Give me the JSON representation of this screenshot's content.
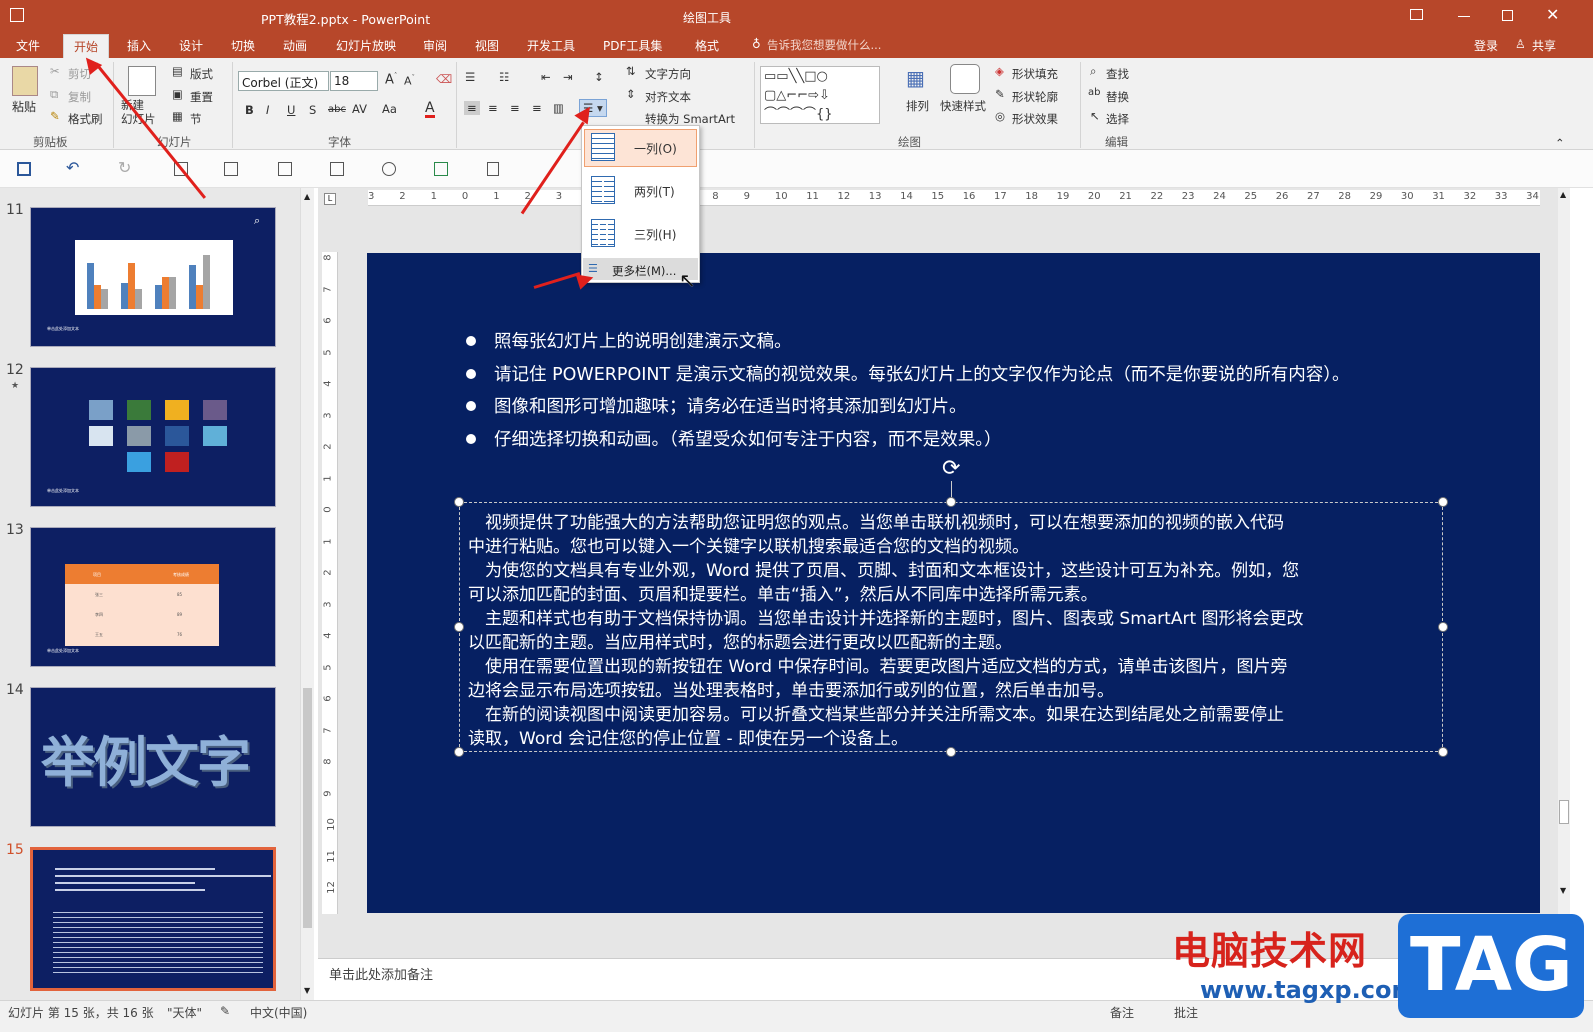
{
  "app": {
    "title": "PPT教程2.pptx - PowerPoint",
    "context_tool": "绘图工具",
    "search_hint": "告诉我您想要做什么...",
    "login": "登录",
    "share": "共享"
  },
  "tabs": [
    "文件",
    "开始",
    "插入",
    "设计",
    "切换",
    "动画",
    "幻灯片放映",
    "审阅",
    "视图",
    "开发工具",
    "PDF工具集",
    "格式"
  ],
  "ribbon": {
    "clipboard": {
      "paste": "粘贴",
      "cut": "剪切",
      "copy": "复制",
      "format_painter": "格式刷",
      "group": "剪贴板"
    },
    "slides": {
      "new_slide": "新建\n幻灯片",
      "layout": "版式",
      "reset": "重置",
      "section": "节",
      "group": "幻灯片"
    },
    "font": {
      "font_name": "Corbel (正文)",
      "font_size": "18",
      "group": "字体"
    },
    "paragraph": {
      "text_direction": "文字方向",
      "align_text": "对齐文本",
      "smartart": "转换为 SmartArt",
      "group": "段落"
    },
    "drawing": {
      "arrange": "排列",
      "quick_styles": "快速样式",
      "shape_fill": "形状填充",
      "shape_outline": "形状轮廓",
      "shape_effects": "形状效果",
      "group": "绘图"
    },
    "editing": {
      "find": "查找",
      "replace": "替换",
      "select": "选择",
      "group": "编辑"
    }
  },
  "columns_menu": {
    "one": "一列(O)",
    "two": "两列(T)",
    "three": "三列(H)",
    "more": "更多栏(M)..."
  },
  "thumbnails": [
    {
      "num": "11",
      "caption": "单击此处添加文本"
    },
    {
      "num": "12",
      "caption": "单击此处添加文本"
    },
    {
      "num": "13",
      "caption": "单击此处添加文本",
      "header1": "项目",
      "header2": "考核成绩",
      "rows": [
        [
          "张三",
          "85"
        ],
        [
          "李四",
          "89"
        ],
        [
          "王五",
          "76"
        ]
      ]
    },
    {
      "num": "14",
      "big_text": "举例文字"
    },
    {
      "num": "15"
    }
  ],
  "slide": {
    "bullets": [
      "照每张幻灯片上的说明创建演示文稿。",
      "请记住 POWERPOINT 是演示文稿的视觉效果。每张幻灯片上的文字仅作为论点（而不是你要说的所有内容）。",
      "图像和图形可增加趣味；请务必在适当时将其添加到幻灯片。",
      "仔细选择切换和动画。（希望受众如何专注于内容，而不是效果。）"
    ],
    "paragraph_lines": [
      "　视频提供了功能强大的方法帮助您证明您的观点。当您单击联机视频时，可以在想要添加的视频的嵌入代码",
      "中进行粘贴。您也可以键入一个关键字以联机搜索最适合您的文档的视频。",
      "　为使您的文档具有专业外观，Word 提供了页眉、页脚、封面和文本框设计，这些设计可互为补充。例如，您",
      "可以添加匹配的封面、页眉和提要栏。单击“插入”，然后从不同库中选择所需元素。",
      "　主题和样式也有助于文档保持协调。当您单击设计并选择新的主题时，图片、图表或 SmartArt 图形将会更改",
      "以匹配新的主题。当应用样式时，您的标题会进行更改以匹配新的主题。",
      "　使用在需要位置出现的新按钮在 Word 中保存时间。若要更改图片适应文档的方式，请单击该图片，图片旁",
      "边将会显示布局选项按钮。当处理表格时，单击要添加行或列的位置，然后单击加号。",
      "　在新的阅读视图中阅读更加容易。可以折叠文档某些部分并关注所需文本。如果在达到结尾处之前需要停止",
      "读取，Word 会记住您的停止位置 - 即使在另一个设备上。"
    ]
  },
  "notes_placeholder": "单击此处添加备注",
  "status": {
    "slide_info": "幻灯片 第 15 张，共 16 张",
    "theme": "\"天体\"",
    "language": "中文(中国)",
    "notes": "备注",
    "comments": "批注"
  },
  "watermark": {
    "cn": "电脑技术网",
    "url": "www.tagxp.com",
    "logo": "TAG"
  },
  "colors": {
    "title_bar": "#b7472a",
    "slide_bg": "#062062",
    "arrow": "#e0201c"
  }
}
